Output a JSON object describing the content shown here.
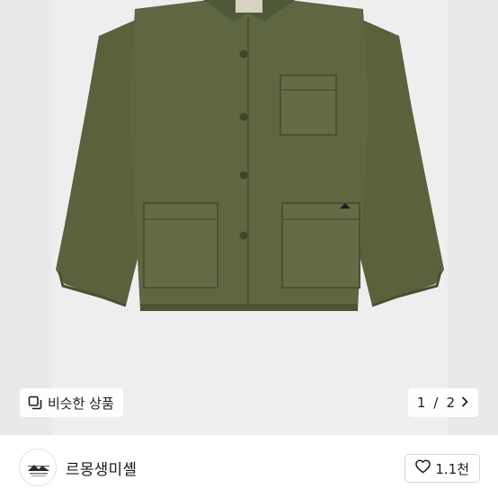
{
  "gallery": {
    "similar_label": "비슷한 상품",
    "pager_current": "1",
    "pager_separator": "/",
    "pager_total": "2"
  },
  "seller": {
    "name": "르몽생미셸",
    "likes": "1.1천"
  },
  "colors": {
    "jacket": "#59613d",
    "background": "#e9e9ea"
  },
  "icons": {
    "similar": "copy-squares-icon",
    "pager_next": "chevron-right-icon",
    "like": "heart-outline-icon"
  }
}
